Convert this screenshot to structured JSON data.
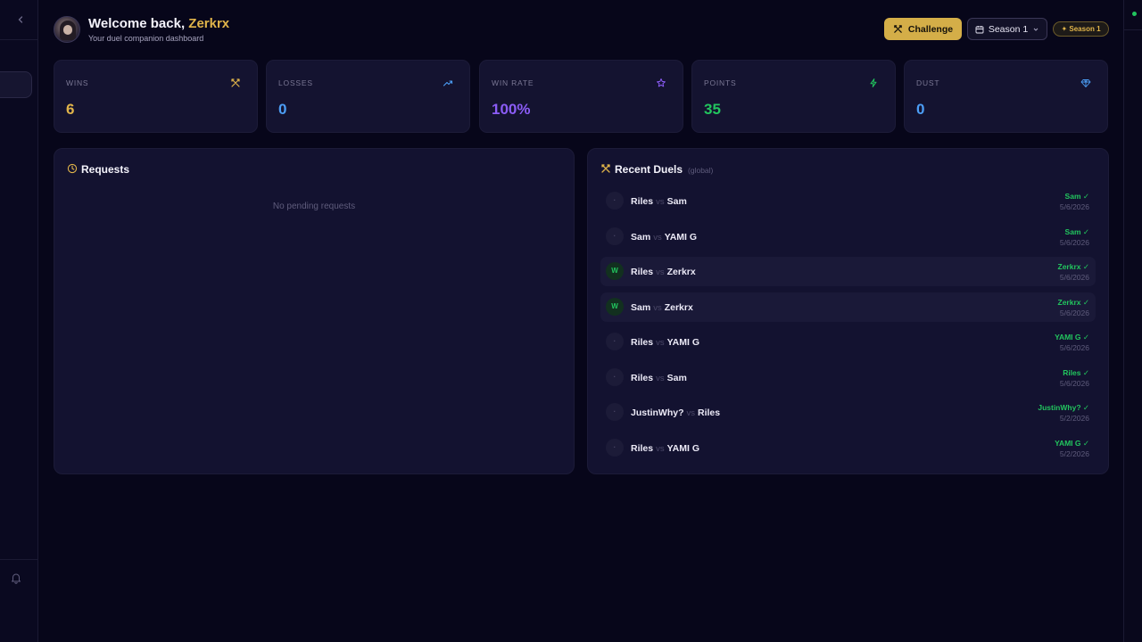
{
  "header": {
    "greeting": "Welcome back, ",
    "username": "Zerkrx",
    "subtitle": "Your duel companion dashboard",
    "challenge_label": "Challenge",
    "season_select_label": "Season 1",
    "season_badge": "✦ Season 1"
  },
  "stats": [
    {
      "label": "WINS",
      "value": "6",
      "color": "#e0b44a",
      "icon": "swords-icon"
    },
    {
      "label": "LOSSES",
      "value": "0",
      "color": "#4c9ef5",
      "icon": "trending-up-icon"
    },
    {
      "label": "WIN RATE",
      "value": "100%",
      "color": "#8b5cf6",
      "icon": "star-icon"
    },
    {
      "label": "POINTS",
      "value": "35",
      "color": "#22c55e",
      "icon": "bolt-icon"
    },
    {
      "label": "DUST",
      "value": "0",
      "color": "#4c9ef5",
      "icon": "gem-icon"
    }
  ],
  "requests": {
    "title": "Requests",
    "empty": "No pending requests"
  },
  "recent_duels": {
    "title": "Recent Duels",
    "scope": "(global)",
    "vs": "vs",
    "rows": [
      {
        "p1": "Riles",
        "p2": "Sam",
        "winner": "Sam ✓",
        "date": "5/6/2026",
        "badge": "·",
        "user_win": false
      },
      {
        "p1": "Sam",
        "p2": "YAMI G",
        "winner": "Sam ✓",
        "date": "5/6/2026",
        "badge": "·",
        "user_win": false
      },
      {
        "p1": "Riles",
        "p2": "Zerkrx",
        "winner": "Zerkrx ✓",
        "date": "5/6/2026",
        "badge": "W",
        "user_win": true
      },
      {
        "p1": "Sam",
        "p2": "Zerkrx",
        "winner": "Zerkrx ✓",
        "date": "5/6/2026",
        "badge": "W",
        "user_win": true
      },
      {
        "p1": "Riles",
        "p2": "YAMI G",
        "winner": "YAMI G ✓",
        "date": "5/6/2026",
        "badge": "·",
        "user_win": false
      },
      {
        "p1": "Riles",
        "p2": "Sam",
        "winner": "Riles ✓",
        "date": "5/6/2026",
        "badge": "·",
        "user_win": false
      },
      {
        "p1": "JustinWhy?",
        "p2": "Riles",
        "winner": "JustinWhy? ✓",
        "date": "5/2/2026",
        "badge": "·",
        "user_win": false
      },
      {
        "p1": "Riles",
        "p2": "YAMI G",
        "winner": "YAMI G ✓",
        "date": "5/2/2026",
        "badge": "·",
        "user_win": false
      }
    ]
  }
}
